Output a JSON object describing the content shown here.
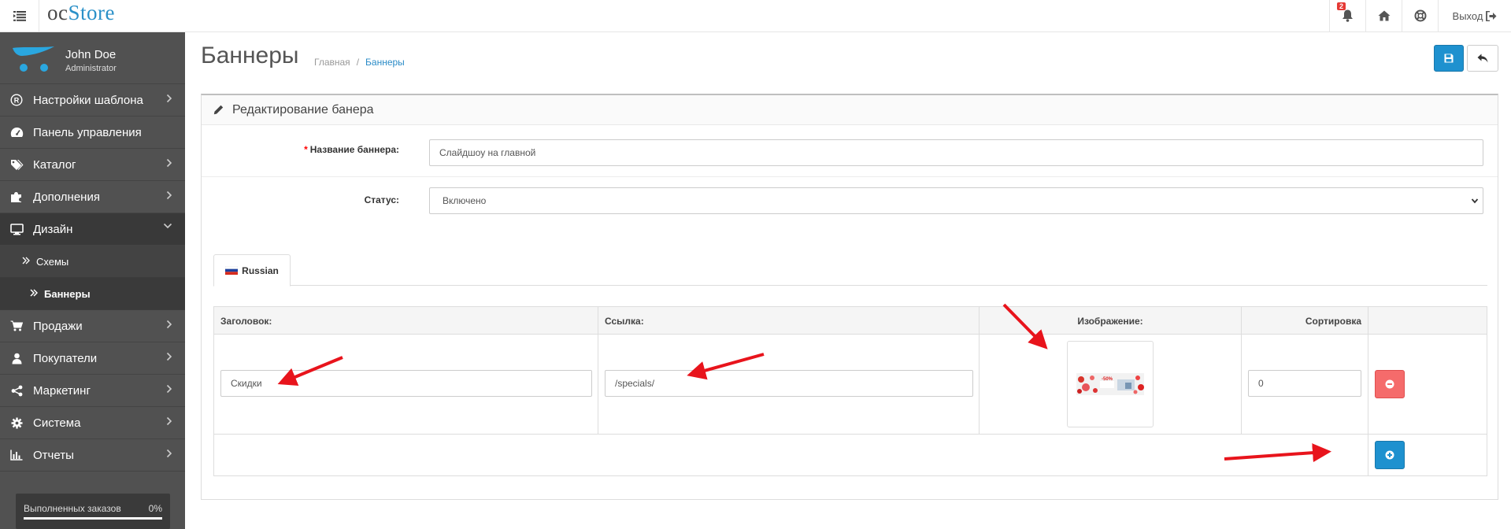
{
  "header": {
    "logo_oc": "oc",
    "logo_store": "Store",
    "notifications_count": "2",
    "logout_label": "Выход"
  },
  "sidebar": {
    "user_name": "John Doe",
    "user_role": "Administrator",
    "items": [
      {
        "label": "Настройки шаблона",
        "icon": "registered-icon"
      },
      {
        "label": "Панель управления",
        "icon": "dashboard-icon"
      },
      {
        "label": "Каталог",
        "icon": "tags-icon"
      },
      {
        "label": "Дополнения",
        "icon": "puzzle-icon"
      },
      {
        "label": "Дизайн",
        "icon": "monitor-icon"
      },
      {
        "label": "Продажи",
        "icon": "cart-icon"
      },
      {
        "label": "Покупатели",
        "icon": "user-icon"
      },
      {
        "label": "Маркетинг",
        "icon": "share-icon"
      },
      {
        "label": "Система",
        "icon": "gear-icon"
      },
      {
        "label": "Отчеты",
        "icon": "bar-chart-icon"
      }
    ],
    "sub_items": [
      {
        "label": "Схемы"
      },
      {
        "label": "Баннеры"
      }
    ],
    "progress": {
      "label": "Выполненных заказов",
      "percent": "0%",
      "value": 0
    }
  },
  "page": {
    "title": "Баннеры",
    "breadcrumb_home": "Главная",
    "breadcrumb_separator": "/",
    "breadcrumb_current": "Баннеры"
  },
  "panel": {
    "heading": "Редактирование банера",
    "name_required_mark": "*",
    "name_label": "Название баннера:",
    "name_value": "Слайдшоу на главной",
    "status_label": "Статус:",
    "status_value": "Включено",
    "tab_label": "Russian"
  },
  "table": {
    "columns": [
      "Заголовок:",
      "Ссылка:",
      "Изображение:",
      "Сортировка"
    ],
    "rows": [
      {
        "title": "Скидки",
        "link": "/specials/",
        "sort": "0",
        "thumb_text": "-50%"
      }
    ]
  },
  "colors": {
    "primary": "#1e91cf",
    "danger": "#f56b6b",
    "sidebar_bg": "#515151",
    "annotation_arrow": "#e8141c"
  }
}
